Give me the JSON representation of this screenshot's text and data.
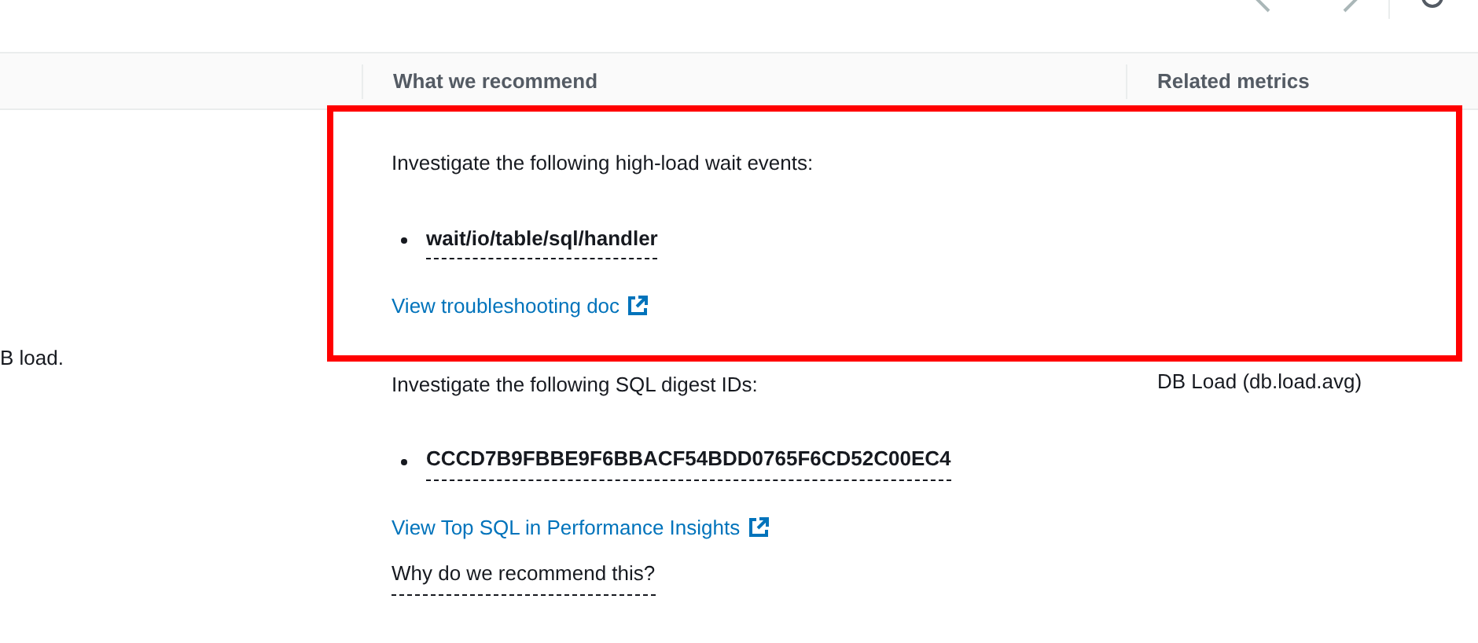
{
  "table": {
    "columns": [
      {
        "label": "What we recommend"
      },
      {
        "label": "Related metrics"
      }
    ],
    "row": {
      "column_1": "B load.",
      "recommendations": [
        {
          "intro": "Investigate the following high-load wait events:",
          "items": [
            "wait/io/table/sql/handler"
          ],
          "link": "View troubleshooting doc"
        },
        {
          "intro": "Investigate the following SQL digest IDs:",
          "items": [
            "CCCD7B9FBBE9F6BBACF54BDD0765F6CD52C00EC4"
          ],
          "link": "View Top SQL in Performance Insights"
        }
      ],
      "why": "Why do we recommend this?",
      "related_metrics": "DB Load (db.load.avg)"
    }
  },
  "highlight": {
    "kind": "annotation"
  }
}
